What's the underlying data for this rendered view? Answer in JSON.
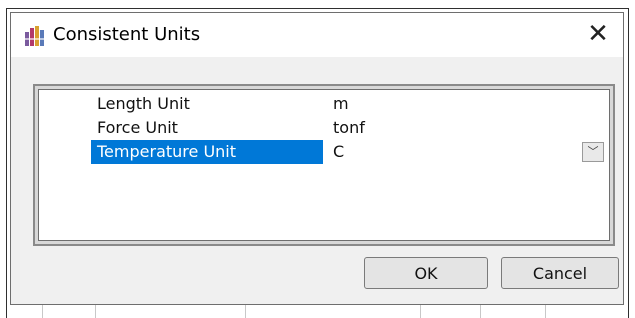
{
  "dialog": {
    "title": "Consistent Units",
    "close_glyph": "✕",
    "icon": "app-icon"
  },
  "grid": {
    "rows": [
      {
        "name": "Length Unit",
        "value": "m",
        "selected": false
      },
      {
        "name": "Force Unit",
        "value": "tonf",
        "selected": false
      },
      {
        "name": "Temperature Unit",
        "value": "C",
        "selected": true
      }
    ],
    "dropdown_glyph": "﹀"
  },
  "buttons": {
    "ok_label": "OK",
    "cancel_label": "Cancel"
  },
  "background": {
    "paren": "("
  },
  "colors": {
    "selection": "#0078d7",
    "dialog_bg": "#f0f0f0"
  }
}
